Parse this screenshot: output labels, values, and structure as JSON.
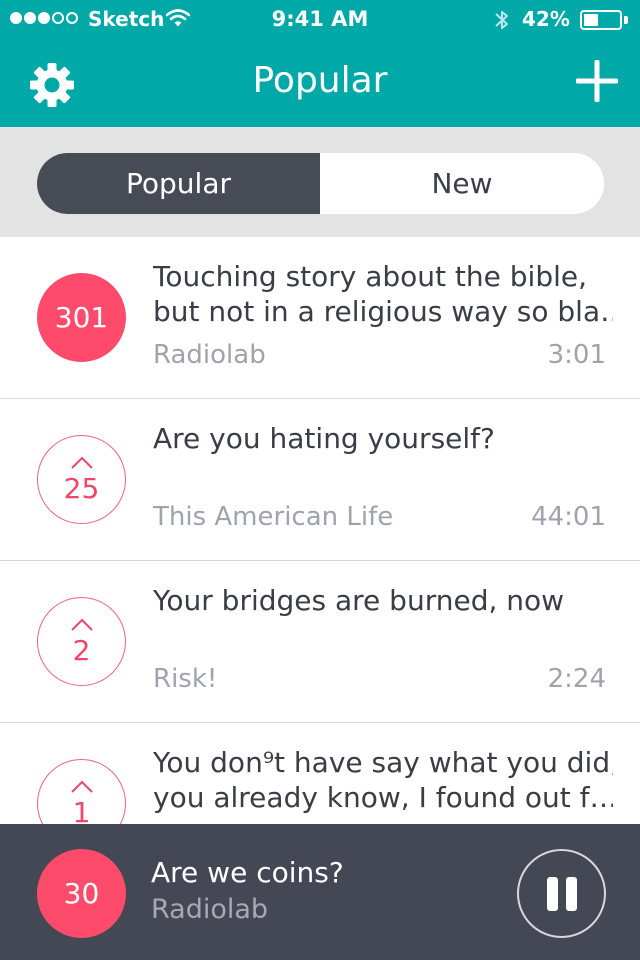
{
  "status_bar": {
    "carrier": "Sketch",
    "time": "9:41 AM",
    "battery_percent": "42%",
    "battery_level": 0.42,
    "signal_strength": 3,
    "signal_max": 5
  },
  "header": {
    "title": "Popular",
    "settings_icon": "gear-icon",
    "add_icon": "plus-icon"
  },
  "segmented": {
    "options": [
      "Popular",
      "New"
    ],
    "selected": "Popular"
  },
  "list": [
    {
      "votes": "301",
      "voted": true,
      "title_lines": [
        "Touching story about the bible,",
        "but not in a religious way so bla…"
      ],
      "source": "Radiolab",
      "duration": "3:01"
    },
    {
      "votes": "25",
      "voted": false,
      "title_lines": [
        "Are you hating yourself?"
      ],
      "source": "This American Life",
      "duration": "44:01"
    },
    {
      "votes": "2",
      "voted": false,
      "title_lines": [
        "Your bridges are burned, now"
      ],
      "source": "Risk!",
      "duration": "2:24"
    },
    {
      "votes": "1",
      "voted": false,
      "title_lines": [
        "You don⁹t have say what you did,",
        "you already know, I found out f…"
      ],
      "source": "",
      "duration": ""
    }
  ],
  "player": {
    "count": "30",
    "title": "Are we coins?",
    "source": "Radiolab",
    "pause_icon": "pause-icon"
  },
  "colors": {
    "header_teal": "#00a8a8",
    "accent_pink": "#ff4b6b",
    "dark_slate": "#434854",
    "muted_text": "#a0a3ab"
  }
}
